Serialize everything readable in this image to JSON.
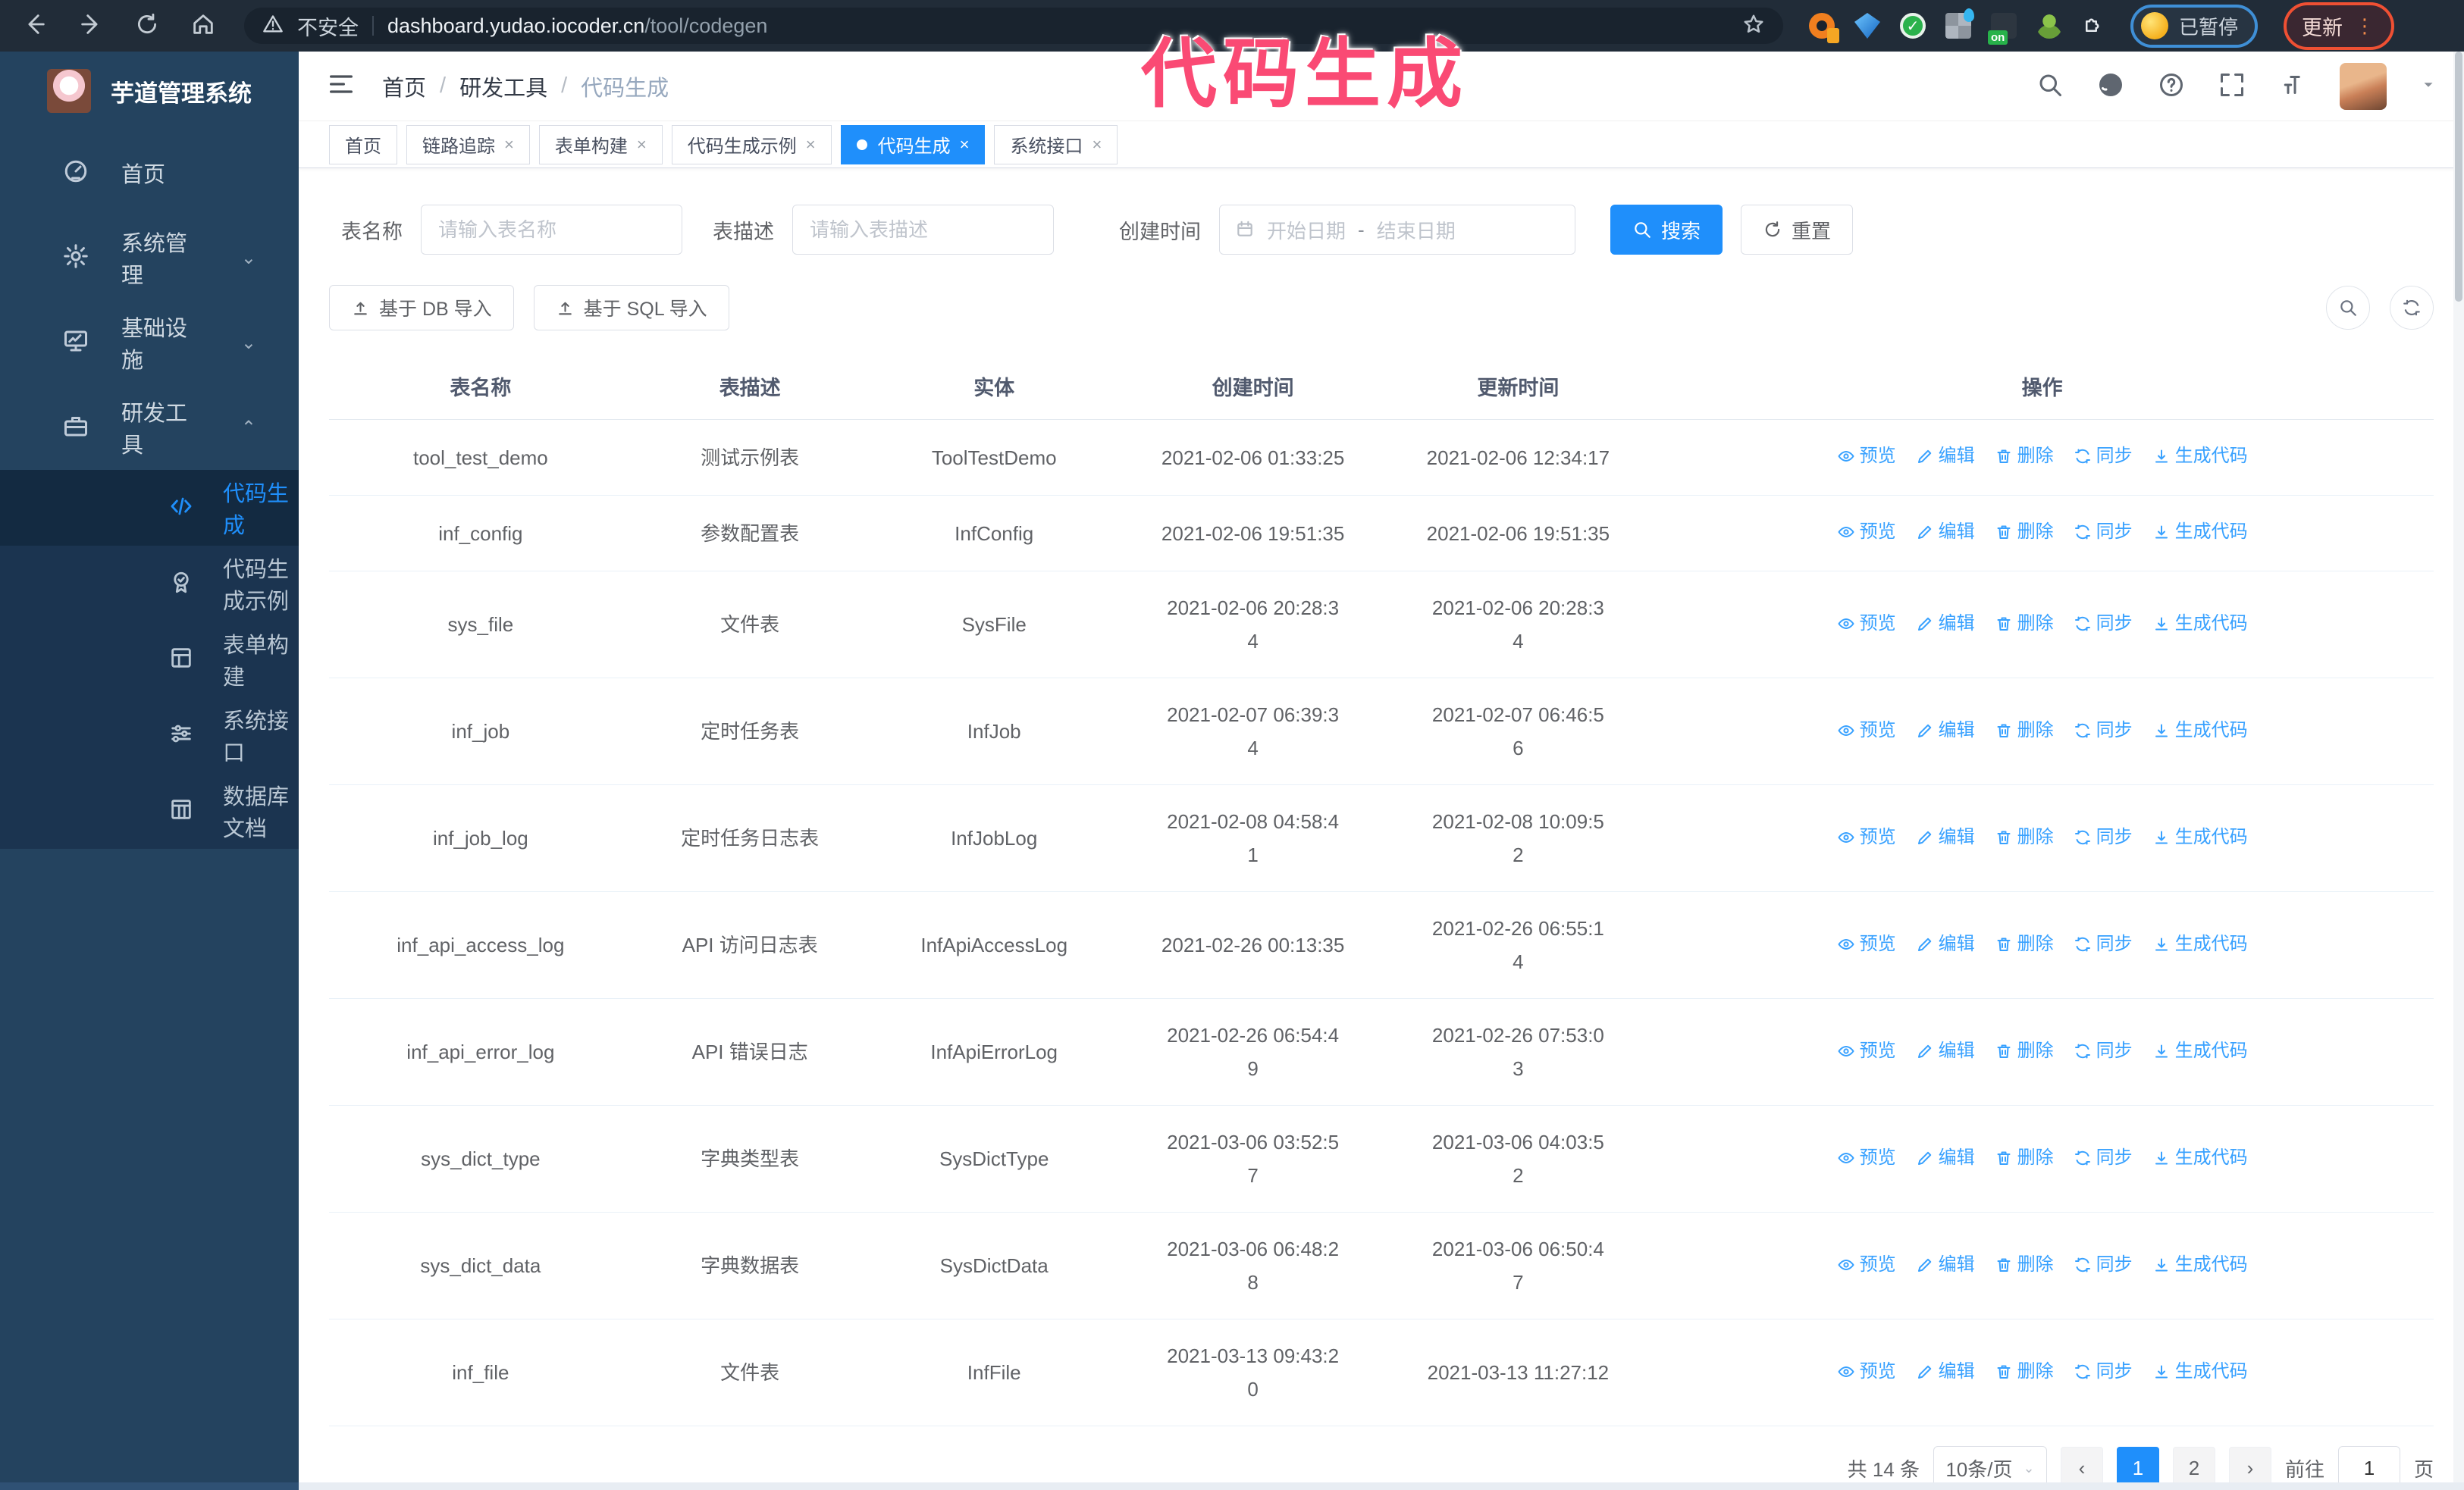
{
  "browser": {
    "security_label": "不安全",
    "url_host": "dashboard.yudao.iocoder.cn",
    "url_path": "/tool/codegen",
    "profile_chip_label": "已暂停",
    "update_button_label": "更新",
    "nav_icons": [
      "back-icon",
      "forward-icon",
      "reload-icon",
      "home-icon"
    ],
    "extension_icons": [
      "star-icon",
      "orange-extension-icon",
      "gem-extension-icon",
      "green-check-extension-icon",
      "grid-extension-icon",
      "on-badge-extension-icon",
      "android-extension-icon",
      "puzzle-extension-icon"
    ]
  },
  "annotation": {
    "title": "代码生成",
    "color": "#fa4a74"
  },
  "sidebar": {
    "app_title": "芋道管理系统",
    "items": [
      {
        "label": "首页",
        "icon": "dashboard-icon",
        "expandable": false
      },
      {
        "label": "系统管理",
        "icon": "gear-icon",
        "expandable": true
      },
      {
        "label": "基础设施",
        "icon": "infrastructure-icon",
        "expandable": true
      },
      {
        "label": "研发工具",
        "icon": "tools-icon",
        "expandable": true,
        "expanded": true
      }
    ],
    "submenu": [
      {
        "label": "代码生成",
        "icon": "code-icon",
        "active": true
      },
      {
        "label": "代码生成示例",
        "icon": "example-badge-icon",
        "active": false
      },
      {
        "label": "表单构建",
        "icon": "form-icon",
        "active": false
      },
      {
        "label": "系统接口",
        "icon": "api-sliders-icon",
        "active": false
      },
      {
        "label": "数据库文档",
        "icon": "database-doc-icon",
        "active": false
      }
    ]
  },
  "header": {
    "breadcrumb": [
      "首页",
      "研发工具",
      "代码生成"
    ],
    "separator": "/",
    "right_icons": [
      "search-icon",
      "github-icon",
      "help-icon",
      "fullscreen-icon",
      "font-size-icon",
      "avatar",
      "caret-down-icon"
    ]
  },
  "tabs": [
    {
      "label": "首页",
      "closable": false,
      "active": false
    },
    {
      "label": "链路追踪",
      "closable": true,
      "active": false
    },
    {
      "label": "表单构建",
      "closable": true,
      "active": false
    },
    {
      "label": "代码生成示例",
      "closable": true,
      "active": false
    },
    {
      "label": "代码生成",
      "closable": true,
      "active": true
    },
    {
      "label": "系统接口",
      "closable": true,
      "active": false
    }
  ],
  "filters": {
    "name_label": "表名称",
    "name_placeholder": "请输入表名称",
    "desc_label": "表描述",
    "desc_placeholder": "请输入表描述",
    "time_label": "创建时间",
    "start_placeholder": "开始日期",
    "range_separator": "-",
    "end_placeholder": "结束日期",
    "search_button": "搜索",
    "reset_button": "重置"
  },
  "toolbar": {
    "import_db_button": "基于 DB 导入",
    "import_sql_button": "基于 SQL 导入"
  },
  "table": {
    "columns": [
      "表名称",
      "表描述",
      "实体",
      "创建时间",
      "更新时间",
      "操作"
    ],
    "actions": {
      "preview": "预览",
      "edit": "编辑",
      "delete": "删除",
      "sync": "同步",
      "generate": "生成代码"
    },
    "rows": [
      {
        "name": "tool_test_demo",
        "desc": "测试示例表",
        "entity": "ToolTestDemo",
        "created": "2021-02-06 01:33:25",
        "updated": "2021-02-06 12:34:17"
      },
      {
        "name": "inf_config",
        "desc": "参数配置表",
        "entity": "InfConfig",
        "created": "2021-02-06 19:51:35",
        "updated": "2021-02-06 19:51:35"
      },
      {
        "name": "sys_file",
        "desc": "文件表",
        "entity": "SysFile",
        "created": "2021-02-06 20:28:3\n4",
        "updated": "2021-02-06 20:28:3\n4"
      },
      {
        "name": "inf_job",
        "desc": "定时任务表",
        "entity": "InfJob",
        "created": "2021-02-07 06:39:3\n4",
        "updated": "2021-02-07 06:46:5\n6"
      },
      {
        "name": "inf_job_log",
        "desc": "定时任务日志表",
        "entity": "InfJobLog",
        "created": "2021-02-08 04:58:4\n1",
        "updated": "2021-02-08 10:09:5\n2"
      },
      {
        "name": "inf_api_access_log",
        "desc": "API 访问日志表",
        "entity": "InfApiAccessLog",
        "created": "2021-02-26 00:13:35",
        "updated": "2021-02-26 06:55:1\n4"
      },
      {
        "name": "inf_api_error_log",
        "desc": "API 错误日志",
        "entity": "InfApiErrorLog",
        "created": "2021-02-26 06:54:4\n9",
        "updated": "2021-02-26 07:53:0\n3"
      },
      {
        "name": "sys_dict_type",
        "desc": "字典类型表",
        "entity": "SysDictType",
        "created": "2021-03-06 03:52:5\n7",
        "updated": "2021-03-06 04:03:5\n2"
      },
      {
        "name": "sys_dict_data",
        "desc": "字典数据表",
        "entity": "SysDictData",
        "created": "2021-03-06 06:48:2\n8",
        "updated": "2021-03-06 06:50:4\n7"
      },
      {
        "name": "inf_file",
        "desc": "文件表",
        "entity": "InfFile",
        "created": "2021-03-13 09:43:2\n0",
        "updated": "2021-03-13 11:27:12"
      }
    ]
  },
  "pagination": {
    "total": "共 14 条",
    "page_size": "10条/页",
    "pages": [
      "1",
      "2"
    ],
    "active_page": "1",
    "goto_label": "前往",
    "goto_value": "1",
    "goto_suffix": "页"
  }
}
